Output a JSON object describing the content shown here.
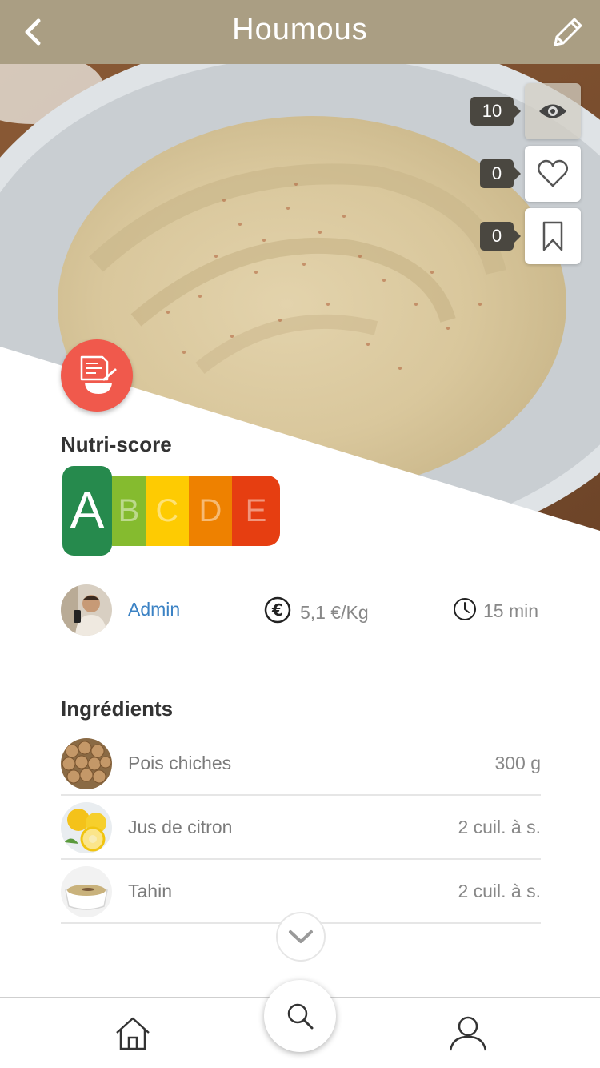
{
  "header": {
    "title": "Houmous"
  },
  "stats": {
    "views": "10",
    "likes": "0",
    "saves": "0"
  },
  "nutri": {
    "label": "Nutri-score",
    "grade": "A",
    "letters": [
      "B",
      "C",
      "D",
      "E"
    ],
    "colors": [
      "#85bb2f",
      "#fecb02",
      "#ee8100",
      "#e63e11"
    ]
  },
  "author": {
    "name": "Admin"
  },
  "price": "5,1 €/Kg",
  "time": "15 min",
  "ingredients": {
    "title": "Ingrédients",
    "items": [
      {
        "name": "Pois chiches",
        "qty": "300 g"
      },
      {
        "name": "Jus de citron",
        "qty": "2 cuil. à s."
      },
      {
        "name": "Tahin",
        "qty": "2 cuil. à s."
      }
    ]
  },
  "colors": {
    "header": "#aa9e83",
    "badge": "#f0594c",
    "nutri_a": "#268a4d",
    "link": "#3b82c4"
  }
}
